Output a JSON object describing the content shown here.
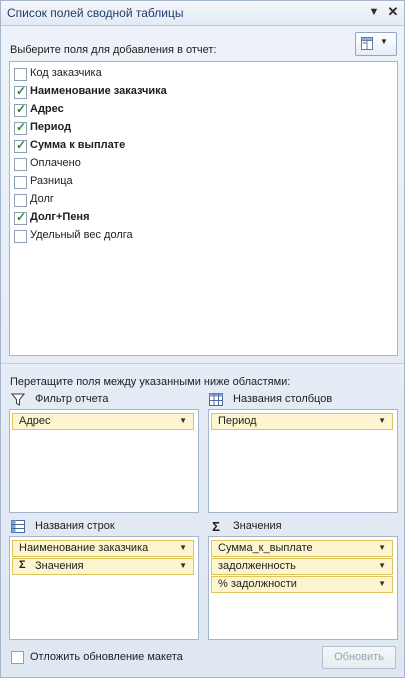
{
  "title": "Список полей сводной таблицы",
  "title_icons": [
    "chevron-down-icon",
    "close-icon"
  ],
  "choose_fields_label": "Выберите поля для добавления в отчет:",
  "fields": [
    {
      "label": "Код заказчика",
      "checked": false
    },
    {
      "label": "Наименование заказчика",
      "checked": true
    },
    {
      "label": "Адрес",
      "checked": true
    },
    {
      "label": "Период",
      "checked": true
    },
    {
      "label": "Сумма к выплате",
      "checked": true
    },
    {
      "label": "Оплачено",
      "checked": false
    },
    {
      "label": "Разница",
      "checked": false
    },
    {
      "label": "Долг",
      "checked": false
    },
    {
      "label": "Долг+Пеня",
      "checked": true
    },
    {
      "label": "Удельный вес долга",
      "checked": false
    }
  ],
  "drag_label": "Перетащите поля между указанными ниже областями:",
  "areas": {
    "filter": {
      "label": "Фильтр отчета",
      "icon": "filter-icon",
      "items": [
        "Адрес"
      ]
    },
    "columns": {
      "label": "Названия столбцов",
      "icon": "column-labels-icon",
      "items": [
        "Период"
      ]
    },
    "rows": {
      "label": "Названия строк",
      "icon": "row-labels-icon",
      "items": [
        "Наименование заказчика",
        "Значения"
      ]
    },
    "values": {
      "label": "Значения",
      "icon": "sigma-icon",
      "items": [
        "Сумма_к_выплате",
        "задолженность",
        "% задолжности"
      ]
    }
  },
  "sigma": "Σ",
  "defer_label": "Отложить обновление макета",
  "update_button": "Обновить",
  "accent_colors": {
    "chip_fill": "#fdf5cf",
    "chip_border": "#e0c35a",
    "check": "#2f8a2f",
    "title_text": "#1e3d6b"
  }
}
